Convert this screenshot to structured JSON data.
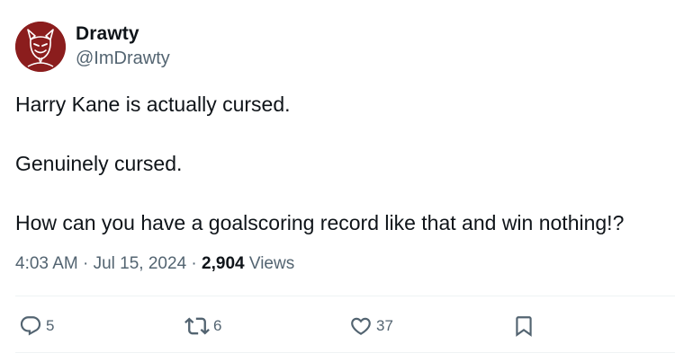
{
  "author": {
    "display_name": "Drawty",
    "handle": "@ImDrawty",
    "avatar_icon": "devil-avatar-icon"
  },
  "tweet": {
    "paragraphs": [
      "Harry Kane is actually cursed.",
      "Genuinely cursed.",
      "How can you have a goalscoring record like that and win nothing!?"
    ]
  },
  "meta": {
    "time": "4:03 AM",
    "separator": "·",
    "date": "Jul 15, 2024",
    "views_count": "2,904",
    "views_label": "Views"
  },
  "actions": {
    "reply": {
      "icon": "reply-icon",
      "count": "5"
    },
    "retweet": {
      "icon": "retweet-icon",
      "count": "6"
    },
    "like": {
      "icon": "heart-icon",
      "count": "37"
    },
    "bookmark": {
      "icon": "bookmark-icon"
    }
  },
  "colors": {
    "text_primary": "#0f1419",
    "text_secondary": "#536471",
    "avatar_bg": "#8b1d1d",
    "divider": "#eff3f4"
  }
}
